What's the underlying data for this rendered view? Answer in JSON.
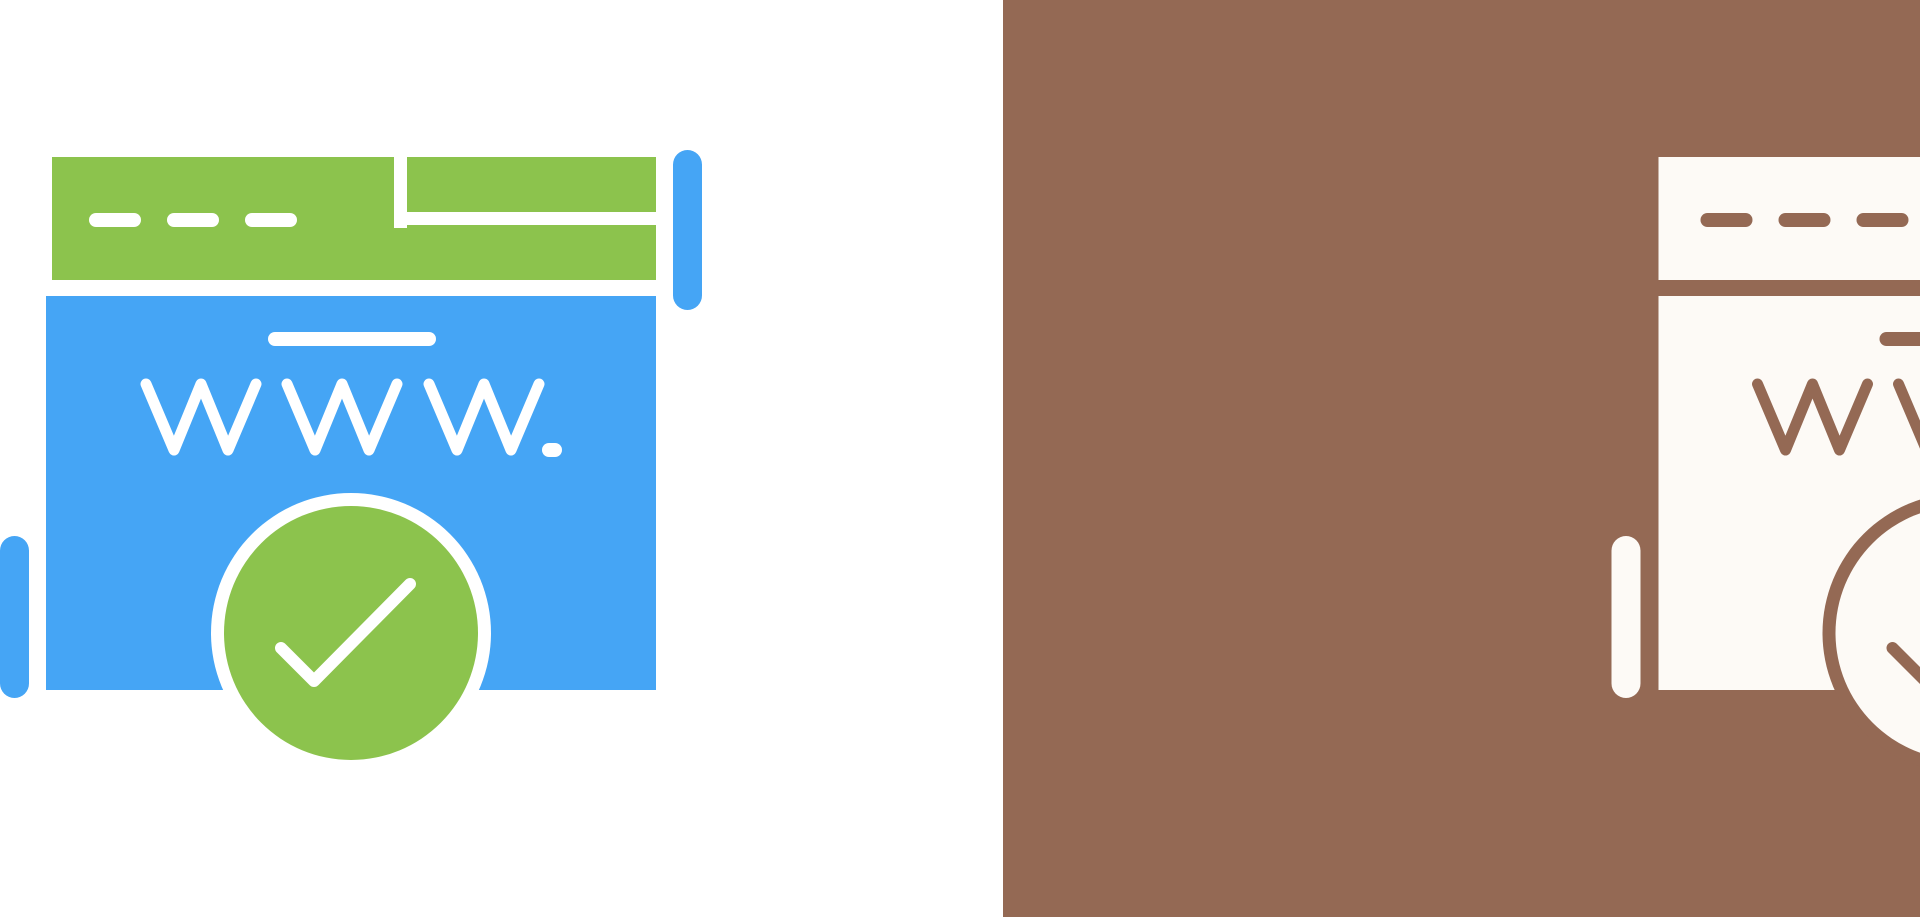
{
  "colors": {
    "background_left": "#ffffff",
    "background_right": "#946954",
    "green": "#8cc34d",
    "blue": "#45a5f5",
    "white": "#ffffff",
    "brown": "#946954",
    "cream": "#fdfaf6"
  },
  "icons": [
    {
      "name": "website-verified-icon",
      "style": "colored"
    },
    {
      "name": "website-verified-icon",
      "style": "glyph"
    }
  ],
  "text": {
    "www_glyph": "www."
  }
}
